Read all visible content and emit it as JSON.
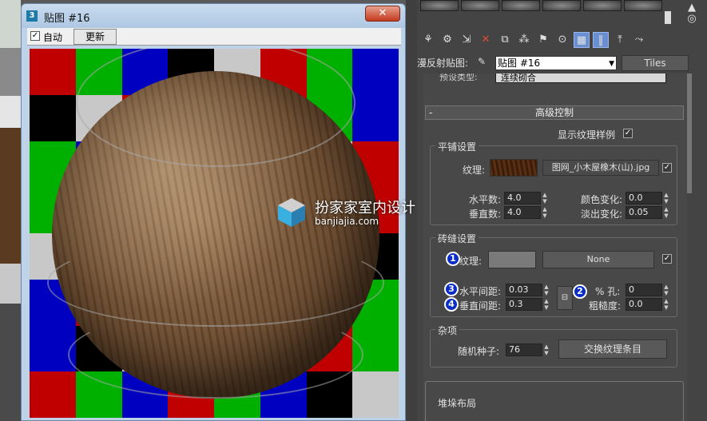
{
  "window": {
    "title": "贴图 #16",
    "logo": "3",
    "close_label": "✕",
    "auto_label": "自动",
    "auto_checked": "✓",
    "update_label": "更新"
  },
  "preview": {
    "checker_colors": [
      "#c00000",
      "#00b000",
      "#0000c0",
      "#000000",
      "#c8c8c8",
      "#c00000",
      "#00b000",
      "#0000c0"
    ]
  },
  "watermark": {
    "cn": "扮家家室内设计",
    "en": "banjiajia.com"
  },
  "panel": {
    "map_label": "漫反射贴图:",
    "map_select": "贴图 #16",
    "map_type": "Tiles",
    "preset_label": "预设类型:",
    "preset_value": "连续砌合",
    "advanced_header": "高级控制",
    "advanced_minus": "-",
    "show_sample_label": "显示纹理样例",
    "show_sample_checked": "✓",
    "tiles_group": {
      "title": "平铺设置",
      "texture_label": "纹理:",
      "texture_file": "图网_小木屋橡木(山).jpg",
      "texture_checked": "✓",
      "horiz_count_label": "水平数:",
      "horiz_count": "4.0",
      "vert_count_label": "垂直数:",
      "vert_count": "4.0",
      "color_var_label": "颜色变化:",
      "color_var": "0.0",
      "fade_var_label": "淡出变化:",
      "fade_var": "0.05"
    },
    "grout_group": {
      "title": "砖缝设置",
      "texture_label": "纹理:",
      "texture_btn": "None",
      "texture_checked": "✓",
      "h_gap_label": "水平间距:",
      "h_gap": "0.03",
      "v_gap_label": "垂直间距:",
      "v_gap": "0.3",
      "holes_label": "% 孔:",
      "holes": "0",
      "rough_label": "粗糙度:",
      "rough": "0.0",
      "markers": [
        "1",
        "2",
        "3",
        "4"
      ]
    },
    "misc_group": {
      "title": "杂项",
      "seed_label": "随机种子:",
      "seed": "76",
      "swap_btn": "交换纹理条目"
    },
    "stack_group": {
      "title": "堆垛布局"
    }
  }
}
